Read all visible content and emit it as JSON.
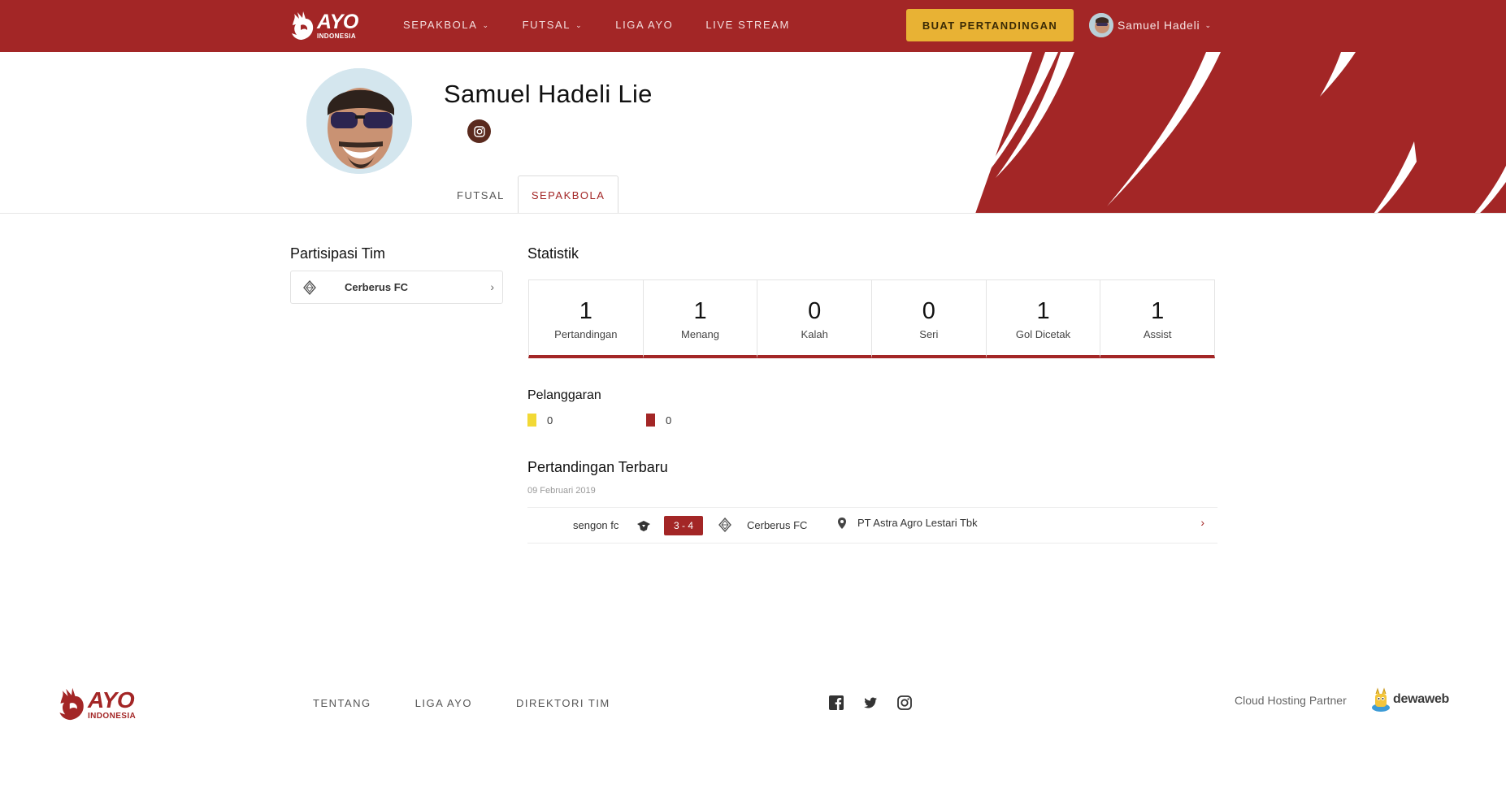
{
  "brand": {
    "logo_main": "AYO",
    "logo_sub": "INDONESIA",
    "primary_color": "#a32626",
    "accent_color": "#e8b234"
  },
  "nav": {
    "items": [
      {
        "label": "SEPAKBOLA",
        "has_dropdown": true
      },
      {
        "label": "FUTSAL",
        "has_dropdown": true
      },
      {
        "label": "LIGA AYO",
        "has_dropdown": false
      },
      {
        "label": "LIVE STREAM",
        "has_dropdown": false
      }
    ],
    "cta_label": "BUAT PERTANDINGAN",
    "user_name": "Samuel Hadeli"
  },
  "profile": {
    "name": "Samuel Hadeli Lie",
    "social_icon": "instagram-icon",
    "tabs": [
      {
        "label": "FUTSAL",
        "active": false
      },
      {
        "label": "SEPAKBOLA",
        "active": true
      }
    ]
  },
  "teams": {
    "title": "Partisipasi Tim",
    "items": [
      {
        "name": "Cerberus FC"
      }
    ]
  },
  "stats": {
    "title": "Statistik",
    "items": [
      {
        "value": "1",
        "label": "Pertandingan"
      },
      {
        "value": "1",
        "label": "Menang"
      },
      {
        "value": "0",
        "label": "Kalah"
      },
      {
        "value": "0",
        "label": "Seri"
      },
      {
        "value": "1",
        "label": "Gol Dicetak"
      },
      {
        "value": "1",
        "label": "Assist"
      }
    ]
  },
  "violations": {
    "title": "Pelanggaran",
    "yellow": {
      "count": "0",
      "color": "#f2d935"
    },
    "red": {
      "count": "0",
      "color": "#a32626"
    }
  },
  "recent_matches": {
    "title": "Pertandingan Terbaru",
    "date": "09 Februari 2019",
    "items": [
      {
        "home": "sengon fc",
        "score": "3 - 4",
        "away": "Cerberus FC",
        "venue": "PT Astra Agro Lestari Tbk"
      }
    ]
  },
  "footer": {
    "links": [
      "TENTANG",
      "LIGA AYO",
      "DIREKTORI TIM"
    ],
    "social": [
      "facebook-icon",
      "twitter-icon",
      "instagram-icon"
    ],
    "partner_label": "Cloud Hosting Partner",
    "partner_name": "dewaweb"
  }
}
